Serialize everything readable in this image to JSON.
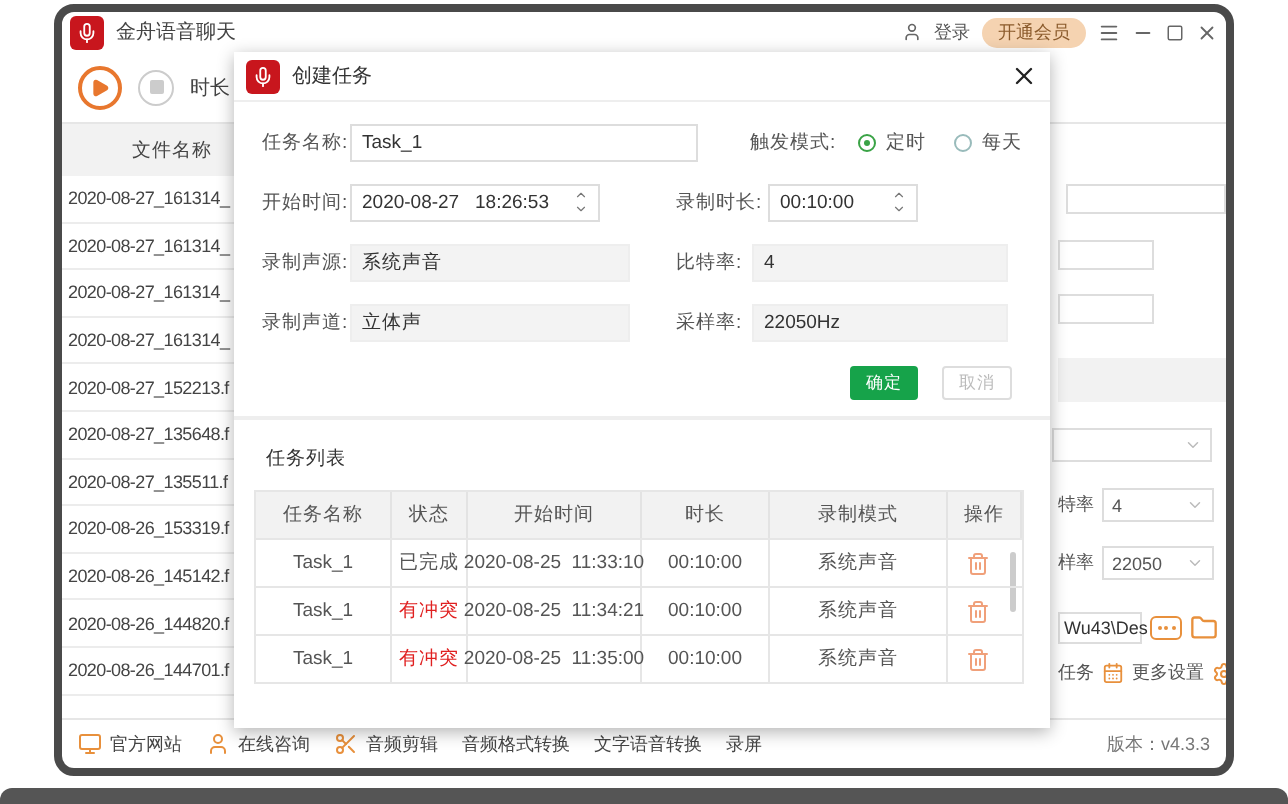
{
  "window": {
    "title": "金舟语音聊天",
    "login": "登录",
    "vip_button": "开通会员"
  },
  "toolbar": {
    "duration_label": "时长"
  },
  "file_list": {
    "header": "文件名称",
    "rows": [
      "2020-08-27_161314_",
      "2020-08-27_161314_",
      "2020-08-27_161314_",
      "2020-08-27_161314_",
      "2020-08-27_152213.f",
      "2020-08-27_135648.f",
      "2020-08-27_135511.f",
      "2020-08-26_153319.f",
      "2020-08-26_145142.f",
      "2020-08-26_144820.f",
      "2020-08-26_144701.f"
    ]
  },
  "right_panel": {
    "bitrate_label": "特率",
    "bitrate": "4",
    "sample_label": "样率",
    "sample": "22050",
    "path": "Wu43\\Des",
    "tasks_label": "任务",
    "more_settings": "更多设置"
  },
  "footer": {
    "links": [
      "官方网站",
      "在线咨询",
      "音频剪辑",
      "音频格式转换",
      "文字语音转换",
      "录屏"
    ],
    "version": "版本：v4.3.3"
  },
  "dialog": {
    "title": "创建任务",
    "name_label": "任务名称:",
    "name": "Task_1",
    "trigger_label": "触发模式:",
    "trigger_options": [
      {
        "label": "定时",
        "selected": true
      },
      {
        "label": "每天",
        "selected": false
      }
    ],
    "fields": [
      {
        "label": "开始时间:",
        "value": "2020-08-27   18:26:53",
        "kind": "spin"
      },
      {
        "label": "录制时长:",
        "value": "00:10:00",
        "kind": "spin"
      },
      {
        "label": "录制声源:",
        "value": "系统声音",
        "kind": "readonly"
      },
      {
        "label": "比特率:",
        "value": "4",
        "kind": "readonly"
      },
      {
        "label": "录制声道:",
        "value": "立体声",
        "kind": "readonly"
      },
      {
        "label": "采样率:",
        "value": "22050Hz",
        "kind": "readonly"
      }
    ],
    "ok_button": "确定",
    "cancel_button": "取消",
    "list_title": "任务列表",
    "columns": [
      "任务名称",
      "状态",
      "开始时间",
      "时长",
      "录制模式",
      "操作"
    ],
    "rows": [
      {
        "name": "Task_1",
        "status": "已完成",
        "kind": "done",
        "start": "2020-08-25  11:33:10",
        "duration": "00:10:00",
        "mode": "系统声音"
      },
      {
        "name": "Task_1",
        "status": "有冲突",
        "kind": "conflict",
        "start": "2020-08-25  11:34:21",
        "duration": "00:10:00",
        "mode": "系统声音"
      },
      {
        "name": "Task_1",
        "status": "有冲突",
        "kind": "conflict",
        "start": "2020-08-25  11:35:00",
        "duration": "00:10:00",
        "mode": "系统声音"
      }
    ]
  }
}
